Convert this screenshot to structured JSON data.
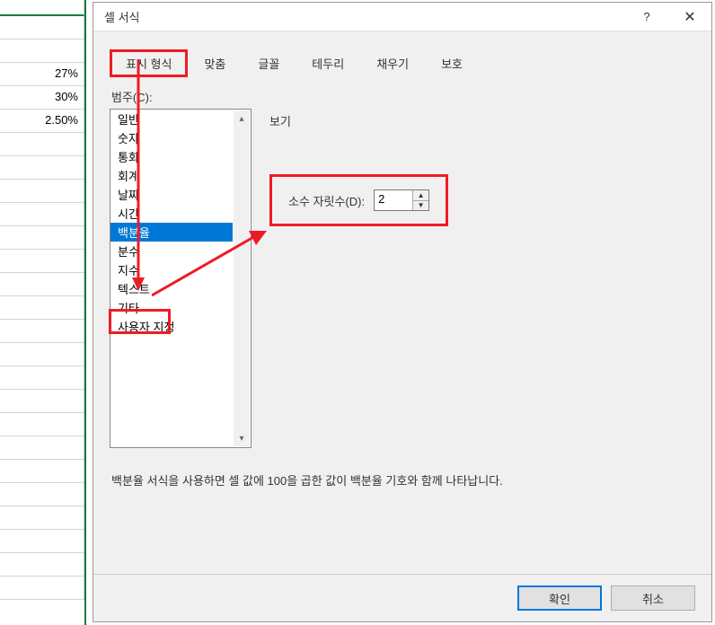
{
  "spreadsheet": {
    "cells": [
      "27%",
      "30%",
      "2.50%"
    ]
  },
  "dialog": {
    "title": "셀 서식",
    "help": "?",
    "close": "✕",
    "tabs": [
      "표시 형식",
      "맞춤",
      "글꼴",
      "테두리",
      "채우기",
      "보호"
    ],
    "category_label": "범주(C):",
    "categories": [
      "일반",
      "숫자",
      "통화",
      "회계",
      "날짜",
      "시간",
      "백분율",
      "분수",
      "지수",
      "텍스트",
      "기타",
      "사용자 지정"
    ],
    "selected_category": "백분율",
    "preview_label": "보기",
    "decimal_label": "소수 자릿수(D):",
    "decimal_value": "2",
    "description": "백분율 서식을 사용하면 셀 값에 100을 곱한 값이 백분율 기호와 함께 나타납니다.",
    "ok_button": "확인",
    "cancel_button": "취소"
  }
}
